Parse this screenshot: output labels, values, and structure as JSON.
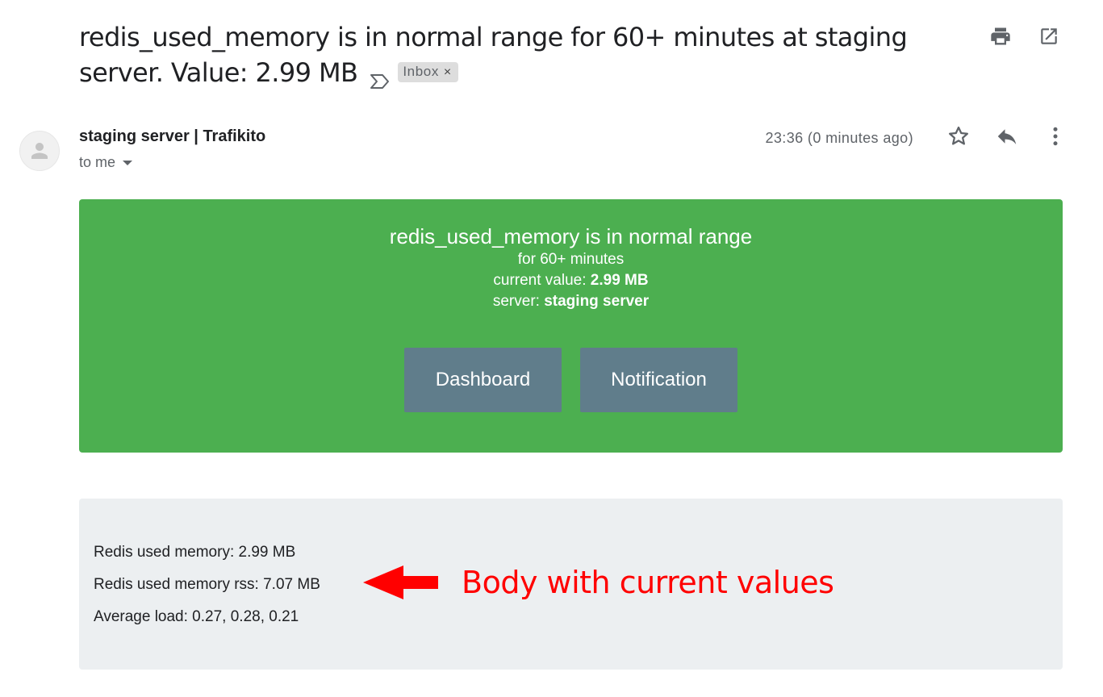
{
  "email": {
    "subject": "redis_used_memory is in normal range for 60+ minutes at staging server. Value: 2.99 MB",
    "label": "Inbox",
    "label_remove": "×",
    "sender": "staging server | Trafikito",
    "recipient": "to me",
    "time": "23:36 (0 minutes ago)"
  },
  "icons": {
    "print": "print-icon",
    "open_new_window": "open-in-new-window-icon",
    "important": "importance-marker-icon",
    "avatar": "default-avatar-icon",
    "star": "star-icon",
    "reply": "reply-icon",
    "more": "more-vert-icon",
    "recipient_dropdown": "caret-down-icon"
  },
  "banner": {
    "title": "redis_used_memory is in normal range",
    "duration": "for 60+ minutes",
    "current_value_label": "current value:",
    "current_value": "2.99 MB",
    "server_label": "server:",
    "server": "staging server",
    "color": "#4caf50",
    "buttons": [
      "Dashboard",
      "Notification"
    ]
  },
  "body": {
    "lines": [
      "Redis used memory: 2.99 MB",
      "Redis used memory rss: 7.07 MB",
      "Average load: 0.27, 0.28, 0.21"
    ]
  },
  "annotation": {
    "text": "Body with current values",
    "color": "#ff0000"
  }
}
